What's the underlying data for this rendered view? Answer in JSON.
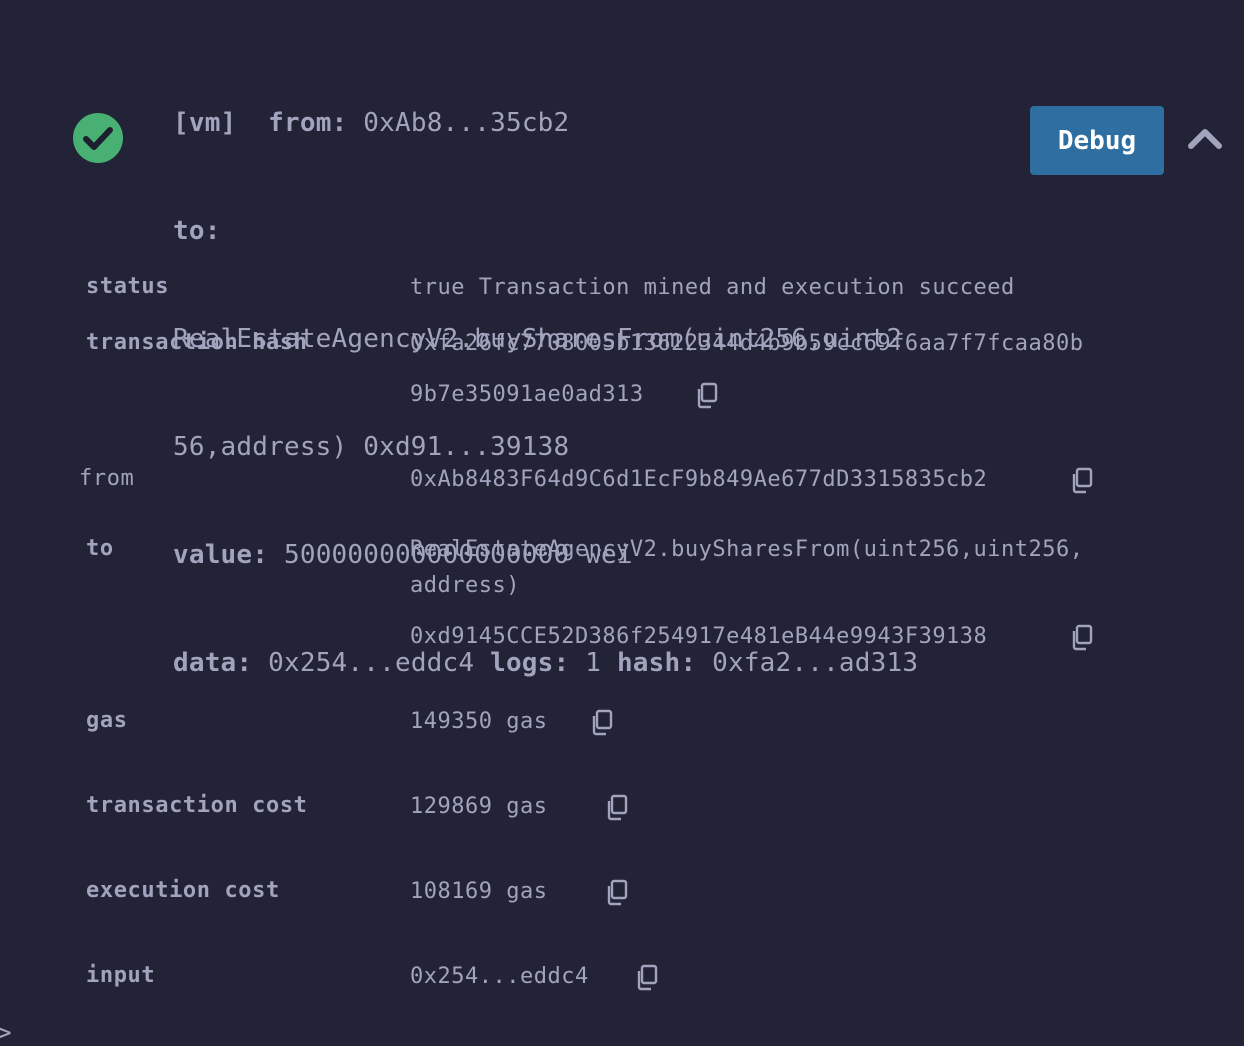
{
  "summary": {
    "vm_tag": "[vm]",
    "from_label": "from:",
    "from_value": "0xAb8...35cb2",
    "to_label": "to:",
    "to_value_line1": "RealEstateAgencyV2.buySharesFrom(uint256,uint2",
    "to_value_line2": "56,address) 0xd91...39138",
    "value_label": "value:",
    "value_value": "500000000000000000 wei",
    "data_label": "data:",
    "data_value": "0x254...eddc4",
    "logs_label": "logs:",
    "logs_value": "1",
    "hash_label": "hash:",
    "hash_value": "0xfa2...ad313"
  },
  "buttons": {
    "debug_label": "Debug"
  },
  "status_icon": "check-circle-icon",
  "details": {
    "status_label": "status",
    "status_value": "true Transaction mined and execution succeed",
    "tx_hash_label": "transaction hash",
    "tx_hash_line1": "0xfa26fc7708005b13622344d4b9b59cc69f6aa7f7fcaa80b",
    "tx_hash_line2": "9b7e35091ae0ad313",
    "from_label": "from",
    "from_value": "0xAb8483F64d9C6d1EcF9b849Ae677dD3315835cb2",
    "to_label": "to",
    "to_value_line1": "RealEstateAgencyV2.buySharesFrom(uint256,uint256,",
    "to_value_line2": "address)",
    "to_address": "0xd9145CCE52D386f254917e481eB44e9943F39138",
    "gas_label": "gas",
    "gas_value": "149350 gas",
    "tx_cost_label": "transaction cost",
    "tx_cost_value": "129869 gas",
    "exec_cost_label": "execution cost",
    "exec_cost_value": "108169 gas",
    "input_label": "input",
    "input_value": "0x254...eddc4"
  },
  "console_prompt": ">",
  "colors": {
    "background": "#222336",
    "text": "#a2a3bd",
    "success": "#47b072",
    "debug_button": "#2e6ea0"
  }
}
